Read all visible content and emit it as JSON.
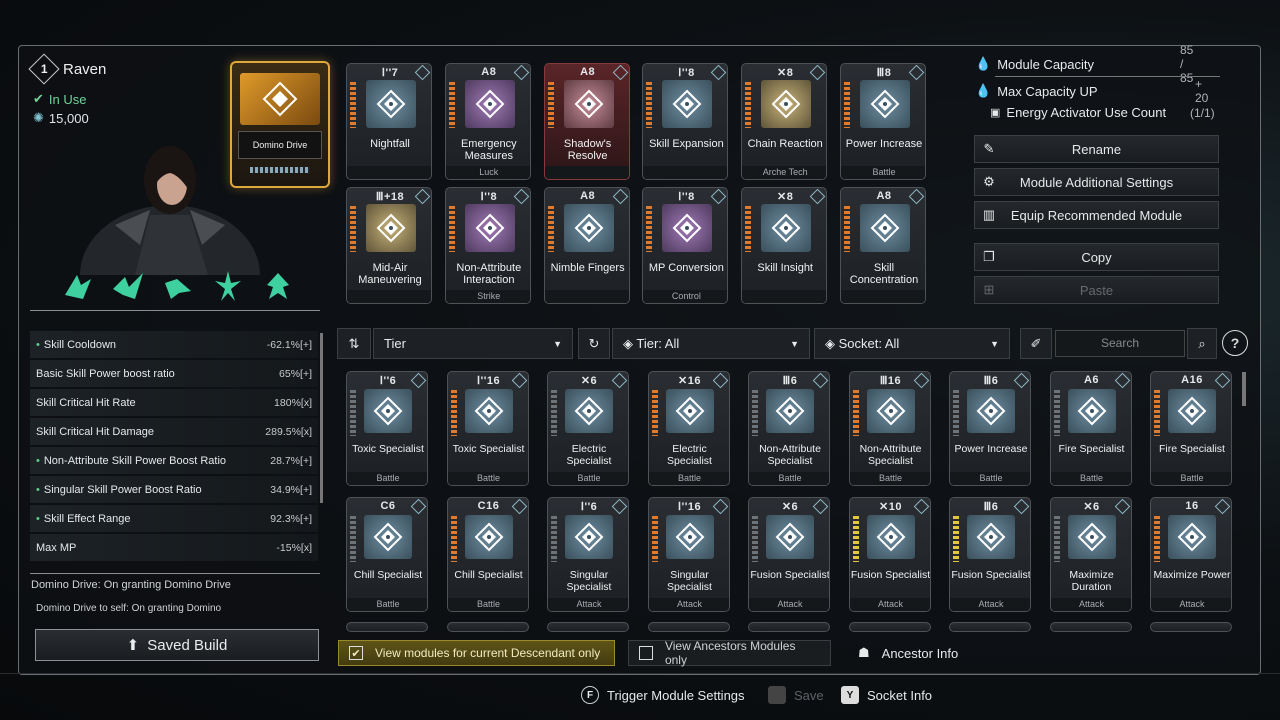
{
  "character": {
    "level": "1",
    "name": "Raven",
    "status": "In Use",
    "credits": "15,000",
    "trigger_module": "Domino Drive"
  },
  "stats": [
    {
      "label": "Skill Cooldown",
      "value": "-62.1%[+]",
      "dot": true
    },
    {
      "label": "Basic Skill Power boost ratio",
      "value": "65%[+]",
      "dot": false
    },
    {
      "label": "Skill Critical Hit Rate",
      "value": "180%[x]",
      "dot": false
    },
    {
      "label": "Skill Critical Hit Damage",
      "value": "289.5%[x]",
      "dot": false
    },
    {
      "label": "Non-Attribute Skill Power Boost Ratio",
      "value": "28.7%[+]",
      "dot": true
    },
    {
      "label": "Singular Skill Power Boost Ratio",
      "value": "34.9%[+]",
      "dot": true
    },
    {
      "label": "Skill Effect Range",
      "value": "92.3%[+]",
      "dot": true
    },
    {
      "label": "Max MP",
      "value": "-15%[x]",
      "dot": false
    }
  ],
  "effect_text": "Domino Drive: On granting Domino Drive",
  "effect_text2": "Domino Drive to self: On granting Domino",
  "saved_build": "Saved Build",
  "equipped": [
    {
      "cost": "Ⅰ''7",
      "name": "Nightfall",
      "socket": "",
      "style": ""
    },
    {
      "cost": "A8",
      "name": "Emergency Measures",
      "socket": "Luck",
      "style": "purple"
    },
    {
      "cost": "A8",
      "name": "Shadow's Resolve",
      "socket": "",
      "style": "red"
    },
    {
      "cost": "Ⅰ''8",
      "name": "Skill Expansion",
      "socket": "",
      "style": ""
    },
    {
      "cost": "✕8",
      "name": "Chain Reaction",
      "socket": "Arche Tech",
      "style": "gold"
    },
    {
      "cost": "Ⅲ8",
      "name": "Power Increase",
      "socket": "Battle",
      "style": ""
    },
    {
      "cost": "Ⅲ+18",
      "name": "Mid-Air Maneuvering",
      "socket": "",
      "style": "gold"
    },
    {
      "cost": "Ⅰ''8",
      "name": "Non-Attribute Interaction",
      "socket": "Strike",
      "style": "purple"
    },
    {
      "cost": "A8",
      "name": "Nimble Fingers",
      "socket": "",
      "style": ""
    },
    {
      "cost": "Ⅰ''8",
      "name": "MP Conversion",
      "socket": "Control",
      "style": "purple"
    },
    {
      "cost": "✕8",
      "name": "Skill Insight",
      "socket": "",
      "style": ""
    },
    {
      "cost": "A8",
      "name": "Skill Concentration",
      "socket": "",
      "style": ""
    }
  ],
  "capacity": {
    "label": "Module Capacity",
    "value": "85 / 85",
    "max_label": "Max Capacity UP",
    "max_value": "+ 20",
    "energy_label": "Energy Activator Use Count",
    "energy_value": "(1/1)"
  },
  "actions": {
    "rename": "Rename",
    "additional": "Module Additional Settings",
    "recommend": "Equip Recommended Module",
    "copy": "Copy",
    "paste": "Paste"
  },
  "filters": {
    "sort": "Tier",
    "tier": "Tier: All",
    "socket": "Socket: All",
    "search_placeholder": "Search"
  },
  "inventory_row1": [
    {
      "cost": "Ⅰ''6",
      "name": "Toxic Specialist",
      "socket": "Battle",
      "bar": "blue"
    },
    {
      "cost": "Ⅰ''16",
      "name": "Toxic Specialist",
      "socket": "Battle",
      "bar": "orange"
    },
    {
      "cost": "✕6",
      "name": "Electric Specialist",
      "socket": "Battle",
      "bar": "blue"
    },
    {
      "cost": "✕16",
      "name": "Electric Specialist",
      "socket": "Battle",
      "bar": "orange"
    },
    {
      "cost": "Ⅲ6",
      "name": "Non-Attribute Specialist",
      "socket": "Battle",
      "bar": "blue"
    },
    {
      "cost": "Ⅲ16",
      "name": "Non-Attribute Specialist",
      "socket": "Battle",
      "bar": "orange"
    },
    {
      "cost": "Ⅲ6",
      "name": "Power Increase",
      "socket": "Battle",
      "bar": "blue"
    },
    {
      "cost": "A6",
      "name": "Fire Specialist",
      "socket": "Battle",
      "bar": "blue"
    },
    {
      "cost": "A16",
      "name": "Fire Specialist",
      "socket": "Battle",
      "bar": "orange"
    }
  ],
  "inventory_row2": [
    {
      "cost": "C6",
      "name": "Chill Specialist",
      "socket": "Battle",
      "bar": "blue"
    },
    {
      "cost": "C16",
      "name": "Chill Specialist",
      "socket": "Battle",
      "bar": "orange"
    },
    {
      "cost": "Ⅰ''6",
      "name": "Singular Specialist",
      "socket": "Attack",
      "bar": "blue"
    },
    {
      "cost": "Ⅰ''16",
      "name": "Singular Specialist",
      "socket": "Attack",
      "bar": "orange"
    },
    {
      "cost": "✕6",
      "name": "Fusion Specialist",
      "socket": "Attack",
      "bar": "blue"
    },
    {
      "cost": "✕10",
      "name": "Fusion Specialist",
      "socket": "Attack",
      "bar": "yellow"
    },
    {
      "cost": "Ⅲ6",
      "name": "Fusion Specialist",
      "socket": "Attack",
      "bar": "yellow"
    },
    {
      "cost": "✕6",
      "name": "Maximize Duration",
      "socket": "Attack",
      "bar": "blue"
    },
    {
      "cost": "16",
      "name": "Maximize Power",
      "socket": "Attack",
      "bar": "orange"
    }
  ],
  "bottom": {
    "current_only": "View modules for current Descendant only",
    "ancestors_only": "View Ancestors Modules only",
    "ancestor_info": "Ancestor Info",
    "trigger_key": "F",
    "trigger_label": "Trigger Module Settings",
    "save_label": "Save",
    "socket_key": "Y",
    "socket_label": "Socket Info"
  }
}
